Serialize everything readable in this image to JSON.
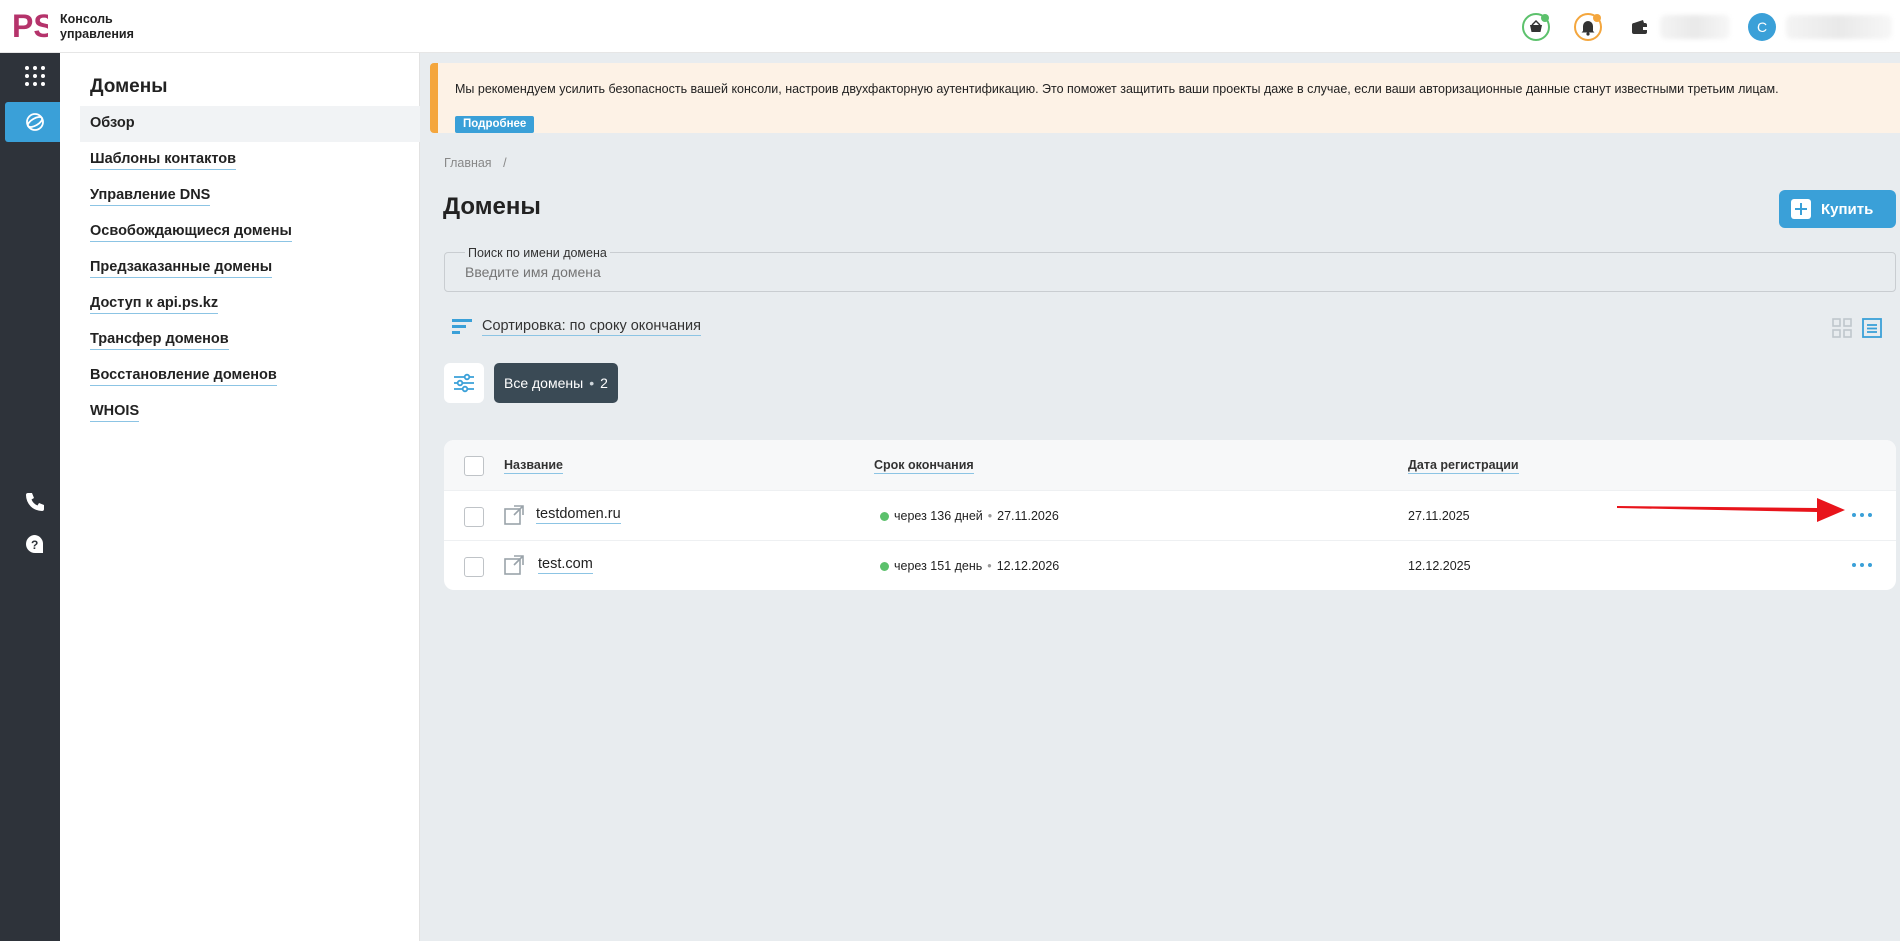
{
  "header": {
    "logo_text": "PS",
    "app_title_line1": "Консоль",
    "app_title_line2": "управления",
    "avatar_letter": "C",
    "colors": {
      "accent": "#3aa0d8",
      "logo": "#b5336b",
      "cart_dot": "#5cc16c",
      "bell_dot": "#f4a63d"
    }
  },
  "rail": {
    "icons": [
      "apps-grid-icon",
      "domains-globe-icon",
      "phone-icon",
      "help-icon",
      "translate-icon"
    ]
  },
  "sidebar": {
    "title": "Домены",
    "items": [
      {
        "label": "Обзор",
        "active": true
      },
      {
        "label": "Шаблоны контактов"
      },
      {
        "label": "Управление DNS"
      },
      {
        "label": "Освобождающиеся домены"
      },
      {
        "label": "Предзаказанные домены"
      },
      {
        "label": "Доступ к api.ps.kz"
      },
      {
        "label": "Трансфер доменов"
      },
      {
        "label": "Восстановление доменов"
      },
      {
        "label": "WHOIS"
      }
    ]
  },
  "banner": {
    "text": "Мы рекомендуем усилить безопасность вашей консоли, настроив двухфакторную аутентификацию. Это поможет защитить ваши проекты даже в случае, если ваши авторизационные данные станут известными третьим лицам.",
    "button": "Подробнее"
  },
  "breadcrumb": {
    "home": "Главная",
    "separator": "/"
  },
  "page": {
    "title": "Домены",
    "buy_button": "Купить"
  },
  "search": {
    "label": "Поиск по имени домена",
    "placeholder": "Введите имя домена"
  },
  "sort": {
    "label": "Сортировка: по сроку окончания"
  },
  "filter": {
    "chip_label": "Все домены",
    "chip_count": "2"
  },
  "table": {
    "columns": {
      "name": "Название",
      "expiry": "Срок окончания",
      "registered": "Дата регистрации"
    },
    "rows": [
      {
        "domain": "testdomen.ru",
        "expires_in": "через 136 дней",
        "expiry_date": "27.11.2026",
        "registered": "27.11.2025"
      },
      {
        "domain": "test.com",
        "expires_in": "через 151 день",
        "expiry_date": "12.12.2026",
        "registered": "12.12.2025"
      }
    ]
  }
}
